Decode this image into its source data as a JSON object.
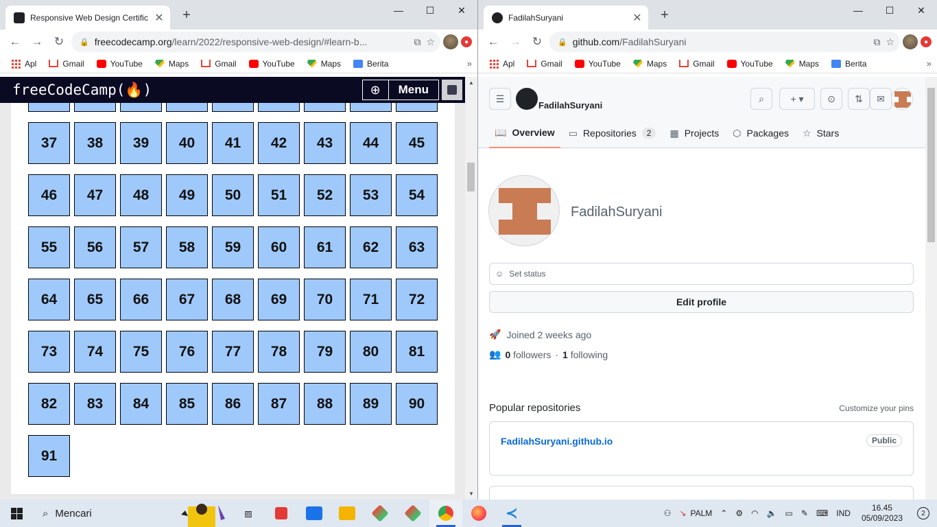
{
  "left_window": {
    "tab_title": "Responsive Web Design Certifica",
    "new_tab": "+",
    "controls": {
      "minimize": "—",
      "maximize": "☐",
      "close": "✕"
    },
    "url_host": "freecodecamp.org",
    "url_rest": "/learn/2022/responsive-web-design/#learn-b...",
    "bookmarks": [
      "Apl",
      "Gmail",
      "YouTube",
      "Maps",
      "Gmail",
      "YouTube",
      "Maps",
      "Berita"
    ],
    "fcc": {
      "logo": "freeCodeCamp(🔥)",
      "menu": "Menu",
      "numbers": [
        "37",
        "38",
        "39",
        "40",
        "41",
        "42",
        "43",
        "44",
        "45",
        "46",
        "47",
        "48",
        "49",
        "50",
        "51",
        "52",
        "53",
        "54",
        "55",
        "56",
        "57",
        "58",
        "59",
        "60",
        "61",
        "62",
        "63",
        "64",
        "65",
        "66",
        "67",
        "68",
        "69",
        "70",
        "71",
        "72",
        "73",
        "74",
        "75",
        "76",
        "77",
        "78",
        "79",
        "80",
        "81",
        "82",
        "83",
        "84",
        "85",
        "86",
        "87",
        "88",
        "89",
        "90",
        "91"
      ],
      "cell_color": "#9fc9fb"
    }
  },
  "right_window": {
    "tab_title": "FadilahSuryani",
    "new_tab": "+",
    "controls": {
      "minimize": "—",
      "maximize": "☐",
      "close": "✕"
    },
    "url_host": "github.com",
    "url_rest": "/FadilahSuryani",
    "bookmarks": [
      "Apl",
      "Gmail",
      "YouTube",
      "Maps",
      "Gmail",
      "YouTube",
      "Maps",
      "Berita"
    ],
    "github": {
      "header_user": "FadilahSuryani",
      "tabs": [
        {
          "label": "Overview",
          "icon": "book-icon"
        },
        {
          "label": "Repositories",
          "icon": "repo-icon",
          "count": "2"
        },
        {
          "label": "Projects",
          "icon": "table-icon"
        },
        {
          "label": "Packages",
          "icon": "package-icon"
        },
        {
          "label": "Stars",
          "icon": "star-icon"
        }
      ],
      "profile_name": "FadilahSuryani",
      "set_status": "Set status",
      "edit_profile": "Edit profile",
      "joined": "Joined 2 weeks ago",
      "followers_count": "0",
      "followers_label": "followers",
      "separator": "·",
      "following_count": "1",
      "following_label": "following",
      "popular_title": "Popular repositories",
      "customize": "Customize your pins",
      "repo_name": "FadilahSuryani.github.io",
      "repo_badge": "Public",
      "accent": "#fd8c73",
      "avatar_color": "#c97b53"
    }
  },
  "taskbar": {
    "search": "Mencari",
    "stock": "PALM",
    "language": "IND",
    "time": "16.45",
    "date": "05/09/2023",
    "notifications": "2"
  }
}
